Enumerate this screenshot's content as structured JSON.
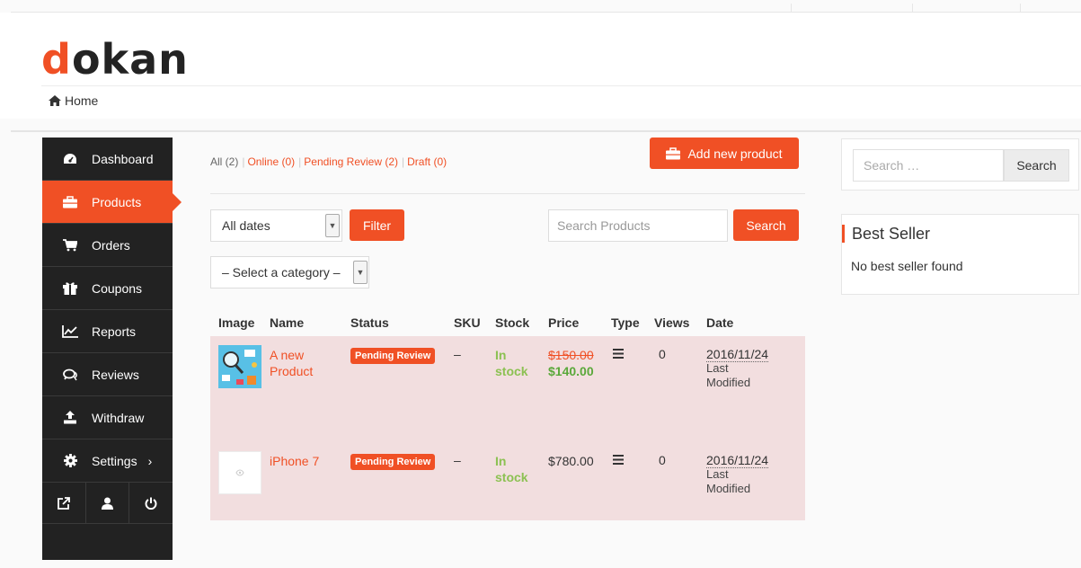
{
  "brand": {
    "logo_first": "d",
    "logo_rest": "okan",
    "accent": "#f05025"
  },
  "breadcrumb": {
    "home_label": "Home",
    "icon": "home-icon"
  },
  "sidebar": {
    "items": [
      {
        "label": "Dashboard",
        "icon": "dashboard-icon"
      },
      {
        "label": "Products",
        "icon": "briefcase-icon",
        "active": true
      },
      {
        "label": "Orders",
        "icon": "cart-icon"
      },
      {
        "label": "Coupons",
        "icon": "gift-icon"
      },
      {
        "label": "Reports",
        "icon": "chart-icon"
      },
      {
        "label": "Reviews",
        "icon": "comments-icon"
      },
      {
        "label": "Withdraw",
        "icon": "upload-icon"
      },
      {
        "label": "Settings",
        "icon": "gear-icon",
        "chevron": "›"
      }
    ],
    "bottom_icons": [
      "external-link-icon",
      "user-icon",
      "power-icon"
    ]
  },
  "filters": {
    "status": {
      "all": "All (2)",
      "online": "Online (0)",
      "pending": "Pending Review (2)",
      "draft": "Draft (0)"
    },
    "add_new_label": "Add new product",
    "date_value": "All dates",
    "filter_label": "Filter",
    "search_placeholder": "Search Products",
    "search_label": "Search",
    "category_value": "– Select a category –"
  },
  "table": {
    "headers": [
      "Image",
      "Name",
      "Status",
      "SKU",
      "Stock",
      "Price",
      "Type",
      "Views",
      "Date"
    ],
    "rows": [
      {
        "name_line1": "A new",
        "name_line2": "Product",
        "status": "Pending Review",
        "sku": "–",
        "stock_line1": "In",
        "stock_line2": "stock",
        "price_old": "$150.00",
        "price_new": "$140.00",
        "type_icon": "menu-icon",
        "views": "0",
        "date": "2016/11/24",
        "date_note_line1": "Last",
        "date_note_line2": "Modified"
      },
      {
        "name": "iPhone 7",
        "status": "Pending Review",
        "sku": "–",
        "stock_line1": "In",
        "stock_line2": "stock",
        "price": "$780.00",
        "type_icon": "menu-icon",
        "views": "0",
        "date": "2016/11/24",
        "date_note_line1": "Last",
        "date_note_line2": "Modified"
      }
    ]
  },
  "widgets": {
    "search_placeholder": "Search …",
    "search_label": "Search",
    "best_seller_title": "Best Seller",
    "best_seller_empty": "No best seller found"
  }
}
